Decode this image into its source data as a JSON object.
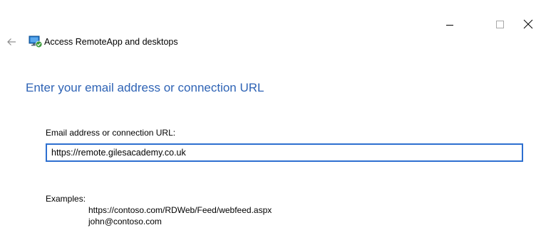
{
  "window": {
    "title": "Access RemoteApp and desktops"
  },
  "form": {
    "heading": "Enter your email address or connection URL",
    "field_label": "Email address or connection URL:",
    "field_value": "https://remote.gilesacademy.co.uk",
    "examples_label": "Examples:",
    "examples": [
      "https://contoso.com/RDWeb/Feed/webfeed.aspx",
      "john@contoso.com"
    ]
  },
  "icons": {
    "back": "back-arrow-icon",
    "app": "remoteapp-icon",
    "minimize": "minimize-icon",
    "maximize": "maximize-icon",
    "close": "close-icon"
  },
  "colors": {
    "heading": "#2e63b5",
    "input_border": "#2d6fd0",
    "background": "#ffffff"
  }
}
